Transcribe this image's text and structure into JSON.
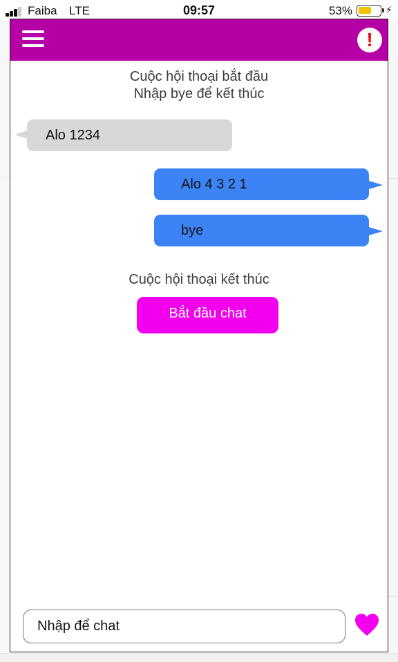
{
  "status_bar": {
    "carrier": "Faiba",
    "network": "LTE",
    "time": "09:57",
    "battery": "53%"
  },
  "header": {
    "menu_icon": "hamburger-menu-icon",
    "alert_icon": "exclamation-icon",
    "alert_glyph": "!",
    "color": "#b400a4"
  },
  "conversation": {
    "start_line1": "Cuộc hội thoại bắt đầu",
    "start_line2": "Nhập bye để kết thúc",
    "messages": [
      {
        "side": "incoming",
        "text": "Alo 1234"
      },
      {
        "side": "outgoing",
        "text": "Alo 4 3 2 1"
      },
      {
        "side": "outgoing",
        "text": "bye"
      }
    ],
    "end_text": "Cuộc hội thoại kết thúc",
    "start_button_label": "Bắt đầu chat"
  },
  "composer": {
    "placeholder": "Nhập để chat",
    "send_icon": "heart-icon"
  },
  "colors": {
    "incoming_bubble": "#d8d8d8",
    "outgoing_bubble": "#3c84f6",
    "accent_button": "#f200ee",
    "heart": "#f200ee"
  }
}
